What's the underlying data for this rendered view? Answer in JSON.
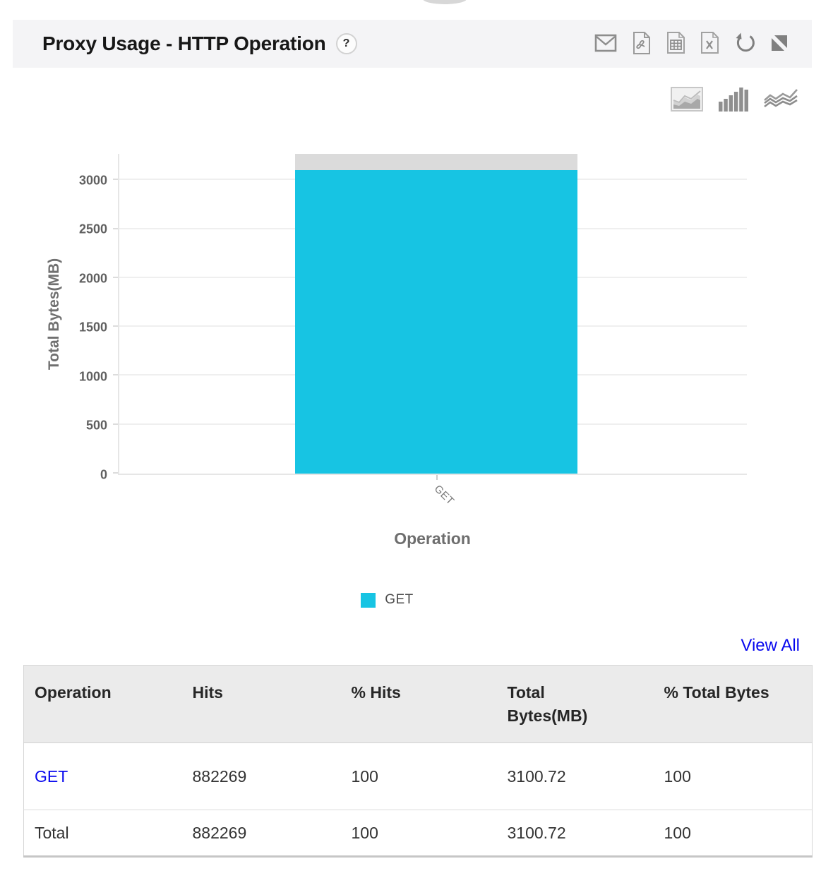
{
  "header": {
    "title": "Proxy Usage - HTTP Operation",
    "help": "?",
    "actions": [
      {
        "label": "Email"
      },
      {
        "label": "Export PDF"
      },
      {
        "label": "Export CSV"
      },
      {
        "label": "Export Excel"
      },
      {
        "label": "Refresh"
      },
      {
        "label": "Expand"
      }
    ]
  },
  "chart_toolbar": {
    "types": [
      "area",
      "bar",
      "line"
    ]
  },
  "chart_data": {
    "type": "bar",
    "title": "Proxy Usage - HTTP Operation",
    "categories": [
      "GET"
    ],
    "values": [
      3100.72
    ],
    "series": [
      {
        "name": "GET",
        "values": [
          3100.72
        ]
      }
    ],
    "xlabel": "Operation",
    "ylabel": "Total Bytes(MB)",
    "ylim": [
      0,
      3270
    ],
    "yticks": [
      0,
      500,
      1000,
      1500,
      2000,
      2500,
      3000
    ],
    "grid": true,
    "legend_position": "bottom",
    "bar_color": "#17c4e3",
    "bar_remainder_color": "#dbdbdb"
  },
  "legend": {
    "items": [
      {
        "label": "GET",
        "color": "#17c4e3"
      }
    ]
  },
  "links": {
    "view_all": "View All"
  },
  "table": {
    "columns": [
      "Operation",
      "Hits",
      "% Hits",
      "Total Bytes(MB)",
      "% Total Bytes"
    ],
    "rows": [
      {
        "operation": "GET",
        "hits": "882269",
        "hits_pct": "100",
        "total_bytes_mb": "3100.72",
        "total_bytes_pct": "100"
      },
      {
        "operation": "Total",
        "hits": "882269",
        "hits_pct": "100",
        "total_bytes_mb": "3100.72",
        "total_bytes_pct": "100"
      }
    ]
  },
  "colors": {
    "accent": "#17c4e3",
    "link": "#0707ee",
    "header_bg": "#f4f4f6",
    "table_header_bg": "#ebebeb",
    "bar_cap": "#dbdbdb"
  }
}
